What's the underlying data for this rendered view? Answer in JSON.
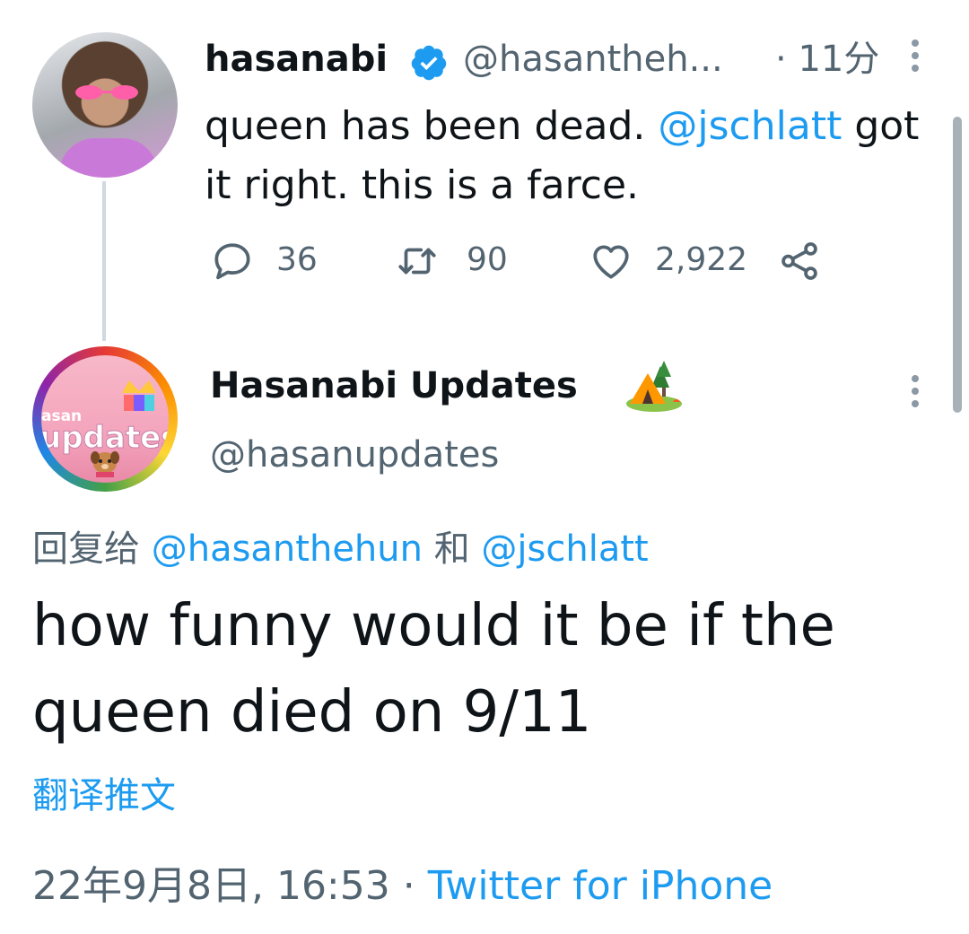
{
  "original_tweet": {
    "display_name": "hasanabi",
    "handle": "@hasantheh...",
    "time_separator": "·",
    "time": "11分",
    "text_parts": [
      "queen has been dead. ",
      "@jschlatt",
      " got it right. this is a farce."
    ],
    "actions": {
      "replies": "36",
      "retweets": "90",
      "likes": "2,922"
    }
  },
  "reply_tweet": {
    "display_name": "Hasanabi Updates",
    "name_emoji": "camping-tent-icon",
    "handle": "@hasanupdates",
    "avatar_text_small": "asan",
    "avatar_text_big": "updates",
    "reply_prefix": "回复给",
    "reply_to_1": "@hasanthehun",
    "reply_joiner": "和",
    "reply_to_2": "@jschlatt",
    "text": "how funny would it be if the queen died on 9/11",
    "translate_label": "翻译推文",
    "timestamp": "22年9月8日, 16:53",
    "meta_separator": "·",
    "source": "Twitter for iPhone"
  },
  "colors": {
    "link": "#1d9bf0",
    "muted": "#536471",
    "text": "#0f1419",
    "verified": "#1d9bf0"
  }
}
